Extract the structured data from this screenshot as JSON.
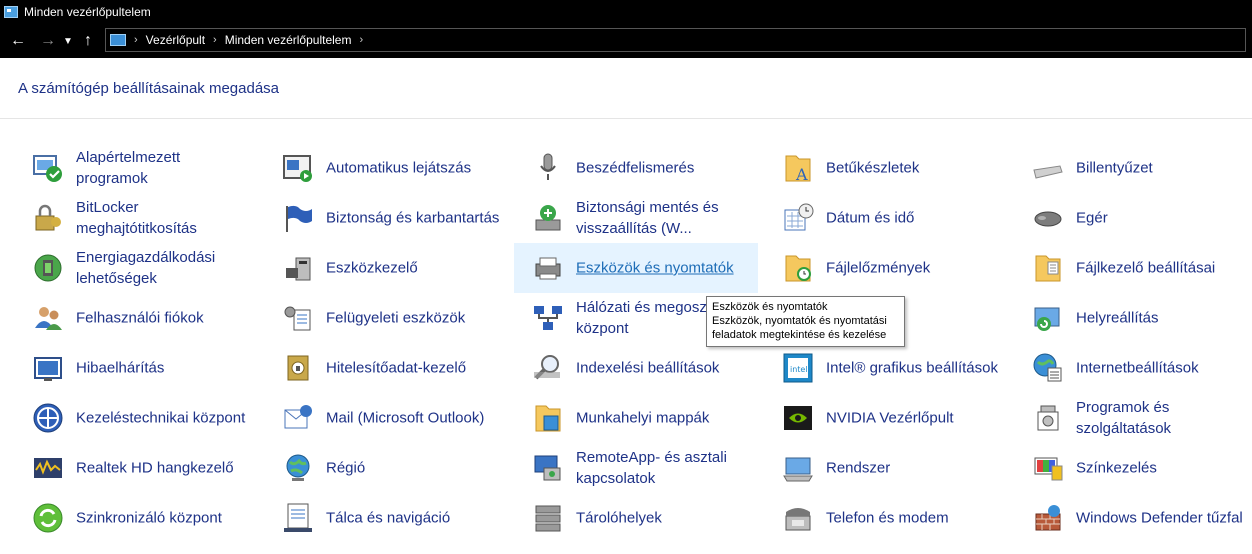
{
  "window": {
    "title": "Minden vezérlőpultelem"
  },
  "address": {
    "crumbs": [
      "Vezérlőpult",
      "Minden vezérlőpultelem"
    ]
  },
  "heading": "A számítógép beállításainak megadása",
  "items": [
    {
      "label": "Alapértelmezett programok",
      "icon": "default-programs-icon"
    },
    {
      "label": "Automatikus lejátszás",
      "icon": "autoplay-icon"
    },
    {
      "label": "Beszédfelismerés",
      "icon": "microphone-icon"
    },
    {
      "label": "Betűkészletek",
      "icon": "fonts-icon"
    },
    {
      "label": "Billentyűzet",
      "icon": "keyboard-icon"
    },
    {
      "label": "BitLocker meghajtótitkosítás",
      "icon": "bitlocker-icon"
    },
    {
      "label": "Biztonság és karbantartás",
      "icon": "flag-icon"
    },
    {
      "label": "Biztonsági mentés és visszaállítás (W...",
      "icon": "backup-icon"
    },
    {
      "label": "Dátum és idő",
      "icon": "date-time-icon"
    },
    {
      "label": "Egér",
      "icon": "mouse-icon"
    },
    {
      "label": "Energiagazdálkodási lehetőségek",
      "icon": "power-options-icon"
    },
    {
      "label": "Eszközkezelő",
      "icon": "device-manager-icon"
    },
    {
      "label": "Eszközök és nyomtatók",
      "icon": "printer-icon"
    },
    {
      "label": "Fájlelőzmények",
      "icon": "file-history-icon"
    },
    {
      "label": "Fájlkezelő beállításai",
      "icon": "folder-options-icon"
    },
    {
      "label": "Felhasználói fiókok",
      "icon": "user-accounts-icon"
    },
    {
      "label": "Felügyeleti eszközök",
      "icon": "admin-tools-icon"
    },
    {
      "label": "Hálózati és megosztási központ",
      "icon": "network-icon"
    },
    {
      "label": "",
      "icon": ""
    },
    {
      "label": "Helyreállítás",
      "icon": "recovery-icon"
    },
    {
      "label": "Hibaelhárítás",
      "icon": "troubleshooting-icon"
    },
    {
      "label": "Hitelesítőadat-kezelő",
      "icon": "credential-manager-icon"
    },
    {
      "label": "Indexelési beállítások",
      "icon": "indexing-icon"
    },
    {
      "label": "Intel® grafikus beállítások",
      "icon": "intel-graphics-icon"
    },
    {
      "label": "Internetbeállítások",
      "icon": "internet-options-icon"
    },
    {
      "label": "Kezeléstechnikai központ",
      "icon": "ease-of-access-icon"
    },
    {
      "label": "Mail (Microsoft Outlook)",
      "icon": "mail-icon"
    },
    {
      "label": "Munkahelyi mappák",
      "icon": "work-folders-icon"
    },
    {
      "label": "NVIDIA Vezérlőpult",
      "icon": "nvidia-icon"
    },
    {
      "label": "Programok és szolgáltatások",
      "icon": "programs-features-icon"
    },
    {
      "label": "Realtek HD hangkezelő",
      "icon": "realtek-audio-icon"
    },
    {
      "label": "Régió",
      "icon": "region-globe-icon"
    },
    {
      "label": "RemoteApp- és asztali kapcsolatok",
      "icon": "remoteapp-icon"
    },
    {
      "label": "Rendszer",
      "icon": "system-icon"
    },
    {
      "label": "Színkezelés",
      "icon": "color-management-icon"
    },
    {
      "label": "Szinkronizáló központ",
      "icon": "sync-center-icon"
    },
    {
      "label": "Tálca és navigáció",
      "icon": "taskbar-icon"
    },
    {
      "label": "Tárolóhelyek",
      "icon": "storage-spaces-icon"
    },
    {
      "label": "Telefon és modem",
      "icon": "phone-modem-icon"
    },
    {
      "label": "Windows Defender tűzfal",
      "icon": "firewall-icon"
    }
  ],
  "tooltip": {
    "line1": "Eszközök és nyomtatók",
    "line2": "Eszközök, nyomtatók és nyomtatási",
    "line3": "feladatok megtekintése és kezelése"
  },
  "colors": {
    "link": "#1e3287",
    "hover_bg": "#e5f3ff",
    "titlebar_bg": "#000000"
  }
}
